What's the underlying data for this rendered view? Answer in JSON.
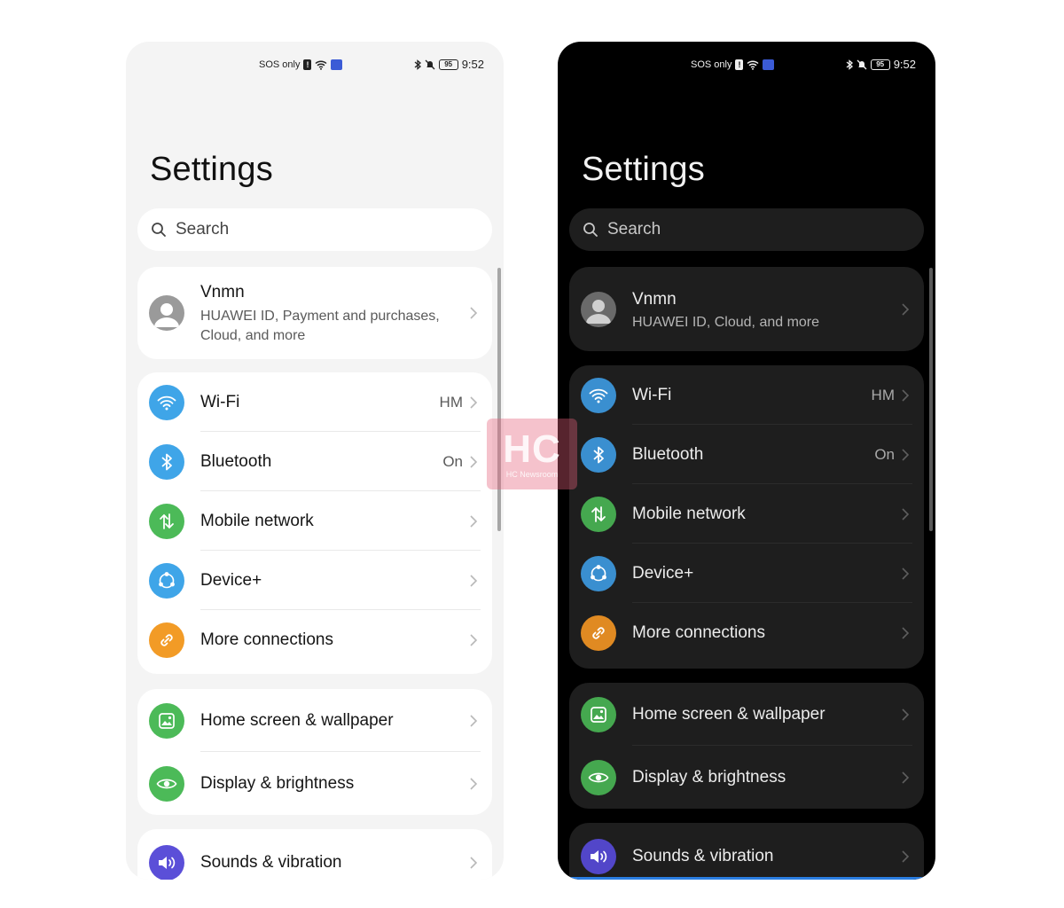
{
  "status_bar": {
    "carrier": "SOS only",
    "battery": "95",
    "time": "9:52"
  },
  "screens": {
    "light": {
      "title": "Settings",
      "search_placeholder": "Search",
      "account": {
        "name": "Vnmn",
        "subtitle": "HUAWEI ID, Payment and purchases, Cloud, and more"
      }
    },
    "dark": {
      "title": "Settings",
      "search_placeholder": "Search",
      "account": {
        "name": "Vnmn",
        "subtitle": "HUAWEI ID, Cloud, and more"
      }
    }
  },
  "connectivity": [
    {
      "label": "Wi-Fi",
      "value": "HM",
      "icon": "wifi-icon",
      "color": "#3fa5e8"
    },
    {
      "label": "Bluetooth",
      "value": "On",
      "icon": "bluetooth-icon",
      "color": "#3fa5e8"
    },
    {
      "label": "Mobile network",
      "value": "",
      "icon": "mobile-data-icon",
      "color": "#4cba58"
    },
    {
      "label": "Device+",
      "value": "",
      "icon": "device-plus-icon",
      "color": "#3fa5e8"
    },
    {
      "label": "More connections",
      "value": "",
      "icon": "link-icon",
      "color": "#f29b26"
    }
  ],
  "display": [
    {
      "label": "Home screen & wallpaper",
      "icon": "wallpaper-icon",
      "color": "#4cba58"
    },
    {
      "label": "Display & brightness",
      "icon": "eye-icon",
      "color": "#4cba58"
    }
  ],
  "sound": [
    {
      "label": "Sounds & vibration",
      "icon": "speaker-icon",
      "color": "#5b4fd8"
    }
  ],
  "watermark": {
    "big": "HC",
    "small": "HC Newsroom"
  }
}
